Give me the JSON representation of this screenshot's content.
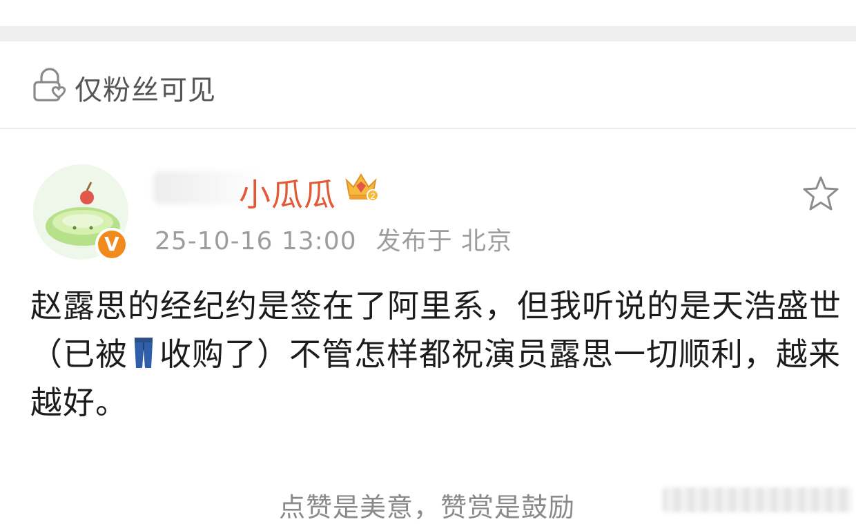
{
  "visibility": {
    "label": "仅粉丝可见",
    "icon": "lock-heart-icon"
  },
  "post": {
    "author": "小瓜瓜",
    "author_color": "#e25a37",
    "badge_icon": "crown-level-icon",
    "verified_mark": "V",
    "timestamp": "25-10-16 13:00",
    "published_at": "发布于 北京",
    "body_part1": "赵露思的经纪约是签在了阿里系，但我听说的是天浩盛世（已被",
    "body_part2": "收购了）不管怎样都祝演员露思一切顺利，越来越好。",
    "inline_emoji": "jeans-icon"
  },
  "footer": {
    "reward_text": "点赞是美意，赞赏是鼓励"
  },
  "colors": {
    "accent_orange": "#f08a1c",
    "meta_gray": "#9d9d9d",
    "body_text": "#1c1c1c"
  }
}
